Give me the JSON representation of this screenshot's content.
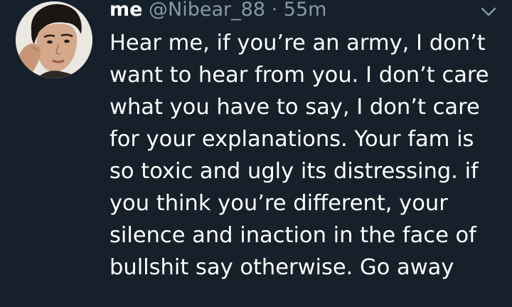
{
  "tweet": {
    "author": {
      "display_name": "me",
      "handle": "@Nibear_88",
      "avatar_icon": "profile-photo"
    },
    "separator": "·",
    "timestamp": "55m",
    "menu_icon": "chevron-down-icon",
    "text_lines": [
      "Hear me, if you’re an army, I don’t",
      "want to hear from you. I don’t care",
      "what you have to say, I don’t care",
      "for your explanations. Your fam is",
      "so toxic and ugly its distressing. if",
      "you think you’re different, your",
      "silence and inaction in the face of",
      "bullshit say otherwise. Go away"
    ]
  },
  "colors": {
    "background": "#15202b",
    "text": "#ffffff",
    "secondary_text": "#8899a6"
  }
}
